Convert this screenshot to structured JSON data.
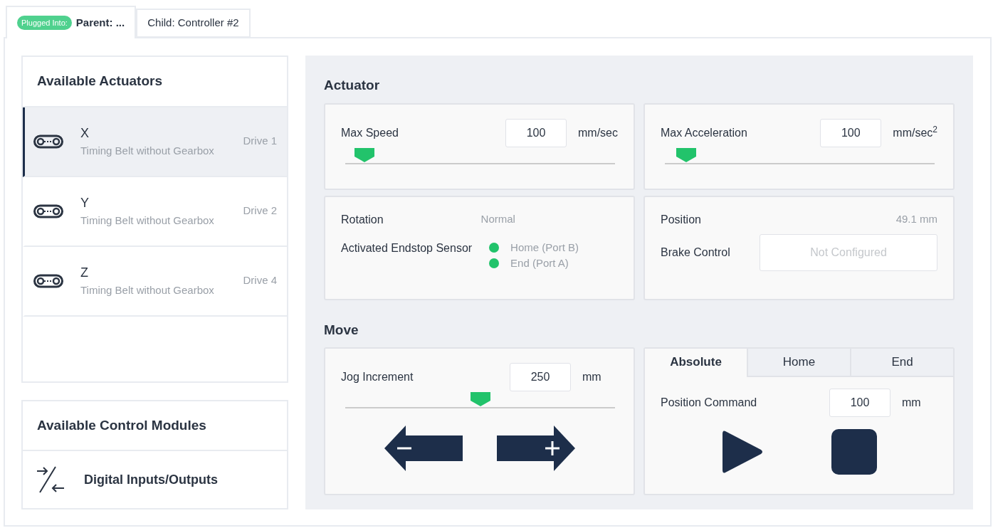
{
  "tabs": [
    {
      "badge": "Plugged Into:",
      "label": "Parent: ...",
      "selected": true
    },
    {
      "label": "Child: Controller #2",
      "selected": false
    }
  ],
  "actuators": {
    "title": "Available Actuators",
    "items": [
      {
        "name": "X",
        "type": "Timing Belt without Gearbox",
        "drive": "Drive 1",
        "selected": true
      },
      {
        "name": "Y",
        "type": "Timing Belt without Gearbox",
        "drive": "Drive 2",
        "selected": false
      },
      {
        "name": "Z",
        "type": "Timing Belt without Gearbox",
        "drive": "Drive 4",
        "selected": false
      }
    ]
  },
  "control_modules": {
    "title": "Available Control Modules",
    "items": [
      {
        "label": "Digital Inputs/Outputs"
      }
    ]
  },
  "actuator": {
    "heading": "Actuator",
    "max_speed": {
      "label": "Max Speed",
      "value": "100",
      "unit": "mm/sec",
      "level": 0.07
    },
    "max_acceleration": {
      "label": "Max Acceleration",
      "value": "100",
      "unit": "mm/sec$^{2}$",
      "level": 0.08
    },
    "rotation": {
      "label": "Rotation",
      "value": "Normal"
    },
    "endstop": {
      "label": "Activated Endstop Sensor",
      "sensors": [
        {
          "label": "Home (Port B)",
          "active": true
        },
        {
          "label": "End (Port A)",
          "active": true
        }
      ]
    },
    "position": {
      "label": "Position",
      "value": "49.1 mm"
    },
    "brake": {
      "label": "Brake Control",
      "value": "Not Configured"
    }
  },
  "move": {
    "heading": "Move",
    "jog": {
      "label": "Jog Increment",
      "value": "250",
      "unit": "mm",
      "level": 0.5
    },
    "tabs": [
      {
        "label": "Absolute",
        "selected": true
      },
      {
        "label": "Home",
        "selected": false
      },
      {
        "label": "End",
        "selected": false
      }
    ],
    "position_command": {
      "label": "Position Command",
      "value": "100",
      "unit": "mm"
    }
  }
}
